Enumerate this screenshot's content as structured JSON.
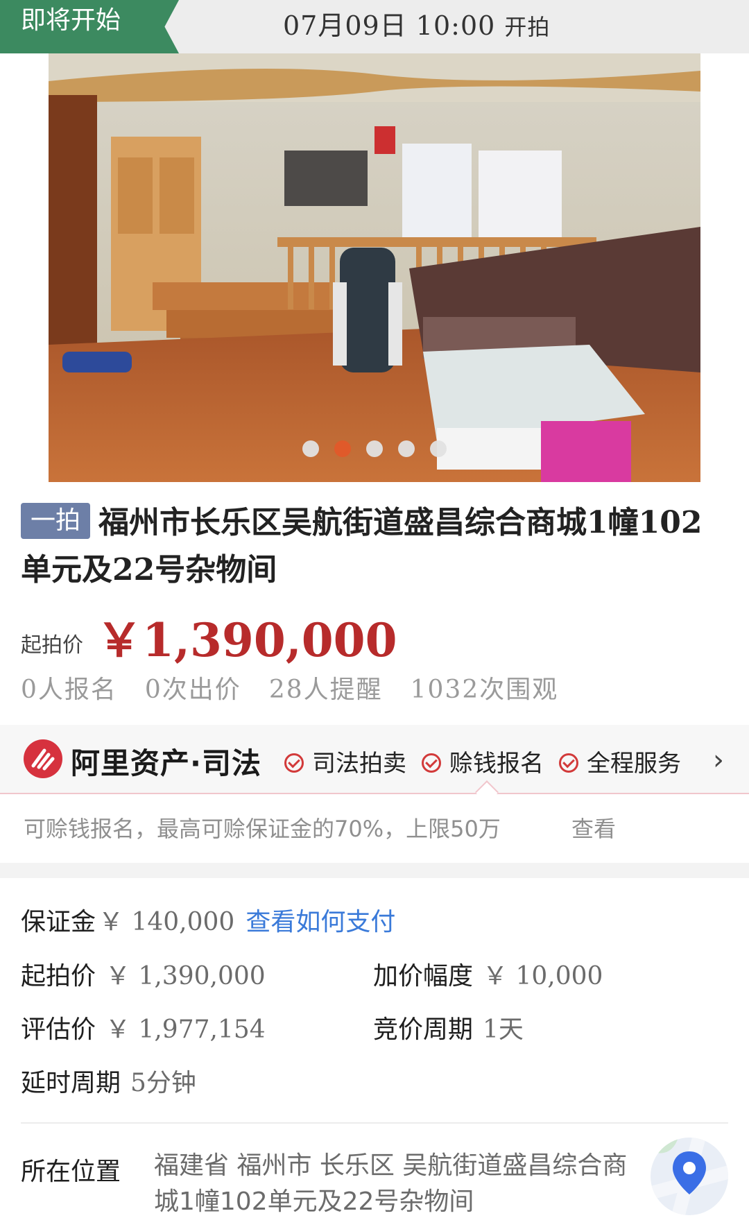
{
  "status_bar": {
    "tag": "即将开始",
    "start_time": "07月09日 10:00",
    "start_suffix": "开拍"
  },
  "gallery": {
    "image_count": 5,
    "active_index": 1
  },
  "listing": {
    "round_badge": "一拍",
    "title": "福州市长乐区吴航街道盛昌综合商城1幢102单元及22号杂物间",
    "start_price_label": "起拍价",
    "start_price": "￥1,390,000",
    "stats": [
      "0人报名",
      "0次出价",
      "28人提醒",
      "1032次围观"
    ]
  },
  "ali_banner": {
    "brand": "阿里资产·司法",
    "features": [
      "司法拍卖",
      "赊钱报名",
      "全程服务"
    ],
    "description": "可赊钱报名，最高可赊保证金的70%，上限50万",
    "view_link": "查看"
  },
  "details": {
    "deposit_label": "保证金",
    "deposit_value": "￥ 140,000",
    "deposit_link": "查看如何支付",
    "start_price_label": "起拍价",
    "start_price_value": "￥ 1,390,000",
    "increment_label": "加价幅度",
    "increment_value": "￥ 10,000",
    "appraisal_label": "评估价",
    "appraisal_value": "￥ 1,977,154",
    "cycle_label": "竞价周期",
    "cycle_value": "1天",
    "delay_label": "延时周期",
    "delay_value": "5分钟",
    "location_label": "所在位置",
    "location_value": "福建省 福州市 长乐区 吴航街道盛昌综合商城1幢102单元及22号杂物间"
  },
  "colors": {
    "status_green": "#3c8a60",
    "price_red": "#b72b2b",
    "badge_blue": "#6d7fa7",
    "link_blue": "#3a7ad9",
    "active_dot": "#e05a2a"
  }
}
